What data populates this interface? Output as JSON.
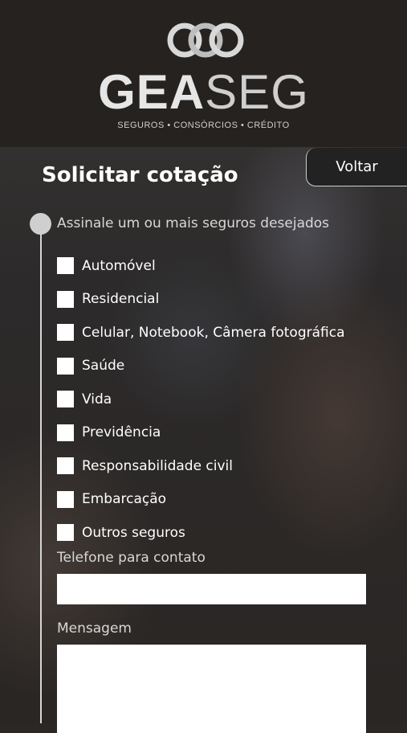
{
  "brand": {
    "name_bold": "GEA",
    "name_light": "SEG",
    "tagline": "SEGUROS • CONSÓRCIOS • CRÉDITO"
  },
  "page": {
    "title": "Solicitar cotação",
    "back_label": "Voltar"
  },
  "form": {
    "question": "Assinale um ou mais seguros desejados",
    "options": [
      "Automóvel",
      "Residencial",
      "Celular, Notebook, Câmera fotográfica",
      "Saúde",
      "Vida",
      "Previdência",
      "Responsabilidade civil",
      "Embarcação",
      "Outros seguros"
    ],
    "phone_label": "Telefone para contato",
    "phone_value": "",
    "message_label": "Mensagem",
    "message_value": ""
  },
  "colors": {
    "header_bg": "#25221f",
    "accent": "#cfcfcf"
  }
}
